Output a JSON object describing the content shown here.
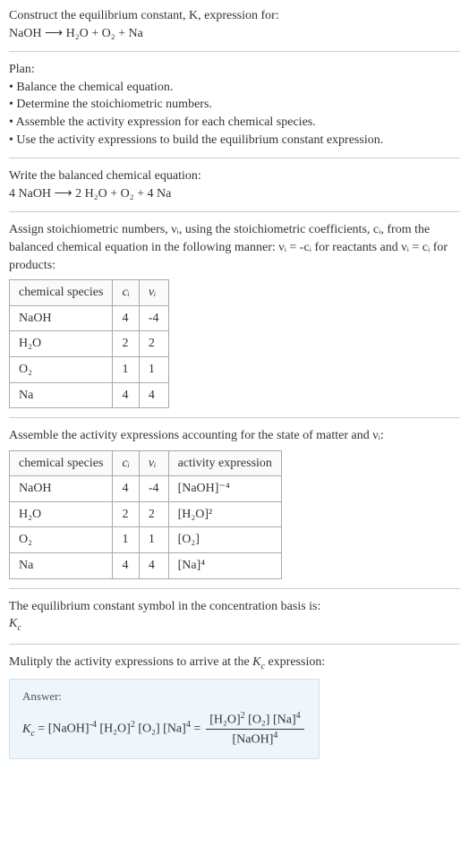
{
  "intro": {
    "line1": "Construct the equilibrium constant, K, expression for:",
    "eq": "NaOH ⟶ H₂O + O₂ + Na"
  },
  "plan": {
    "label": "Plan:",
    "items": [
      "• Balance the chemical equation.",
      "• Determine the stoichiometric numbers.",
      "• Assemble the activity expression for each chemical species.",
      "• Use the activity expressions to build the equilibrium constant expression."
    ]
  },
  "balanced": {
    "label": "Write the balanced chemical equation:",
    "eq": "4 NaOH ⟶ 2 H₂O + O₂ + 4 Na"
  },
  "stoich": {
    "label_a": "Assign stoichiometric numbers, νᵢ, using the stoichiometric coefficients, cᵢ, from the balanced chemical equation in the following manner: νᵢ = -cᵢ for reactants and νᵢ = cᵢ for products:",
    "headers": {
      "h1": "chemical species",
      "h2": "cᵢ",
      "h3": "νᵢ"
    },
    "rows": [
      {
        "s": "NaOH",
        "c": "4",
        "v": "-4"
      },
      {
        "s": "H₂O",
        "c": "2",
        "v": "2"
      },
      {
        "s": "O₂",
        "c": "1",
        "v": "1"
      },
      {
        "s": "Na",
        "c": "4",
        "v": "4"
      }
    ]
  },
  "activity": {
    "label": "Assemble the activity expressions accounting for the state of matter and νᵢ:",
    "headers": {
      "h1": "chemical species",
      "h2": "cᵢ",
      "h3": "νᵢ",
      "h4": "activity expression"
    },
    "rows": [
      {
        "s": "NaOH",
        "c": "4",
        "v": "-4",
        "a": "[NaOH]⁻⁴"
      },
      {
        "s": "H₂O",
        "c": "2",
        "v": "2",
        "a": "[H₂O]²"
      },
      {
        "s": "O₂",
        "c": "1",
        "v": "1",
        "a": "[O₂]"
      },
      {
        "s": "Na",
        "c": "4",
        "v": "4",
        "a": "[Na]⁴"
      }
    ]
  },
  "symbol": {
    "label": "The equilibrium constant symbol in the concentration basis is:",
    "sym": "K_c"
  },
  "multiply": {
    "label": "Mulitply the activity expressions to arrive at the K_c expression:"
  },
  "answer": {
    "title": "Answer:",
    "lhs": "K_c = [NaOH]⁻⁴ [H₂O]² [O₂] [Na]⁴ = ",
    "num": "[H₂O]² [O₂] [Na]⁴",
    "den": "[NaOH]⁴"
  }
}
